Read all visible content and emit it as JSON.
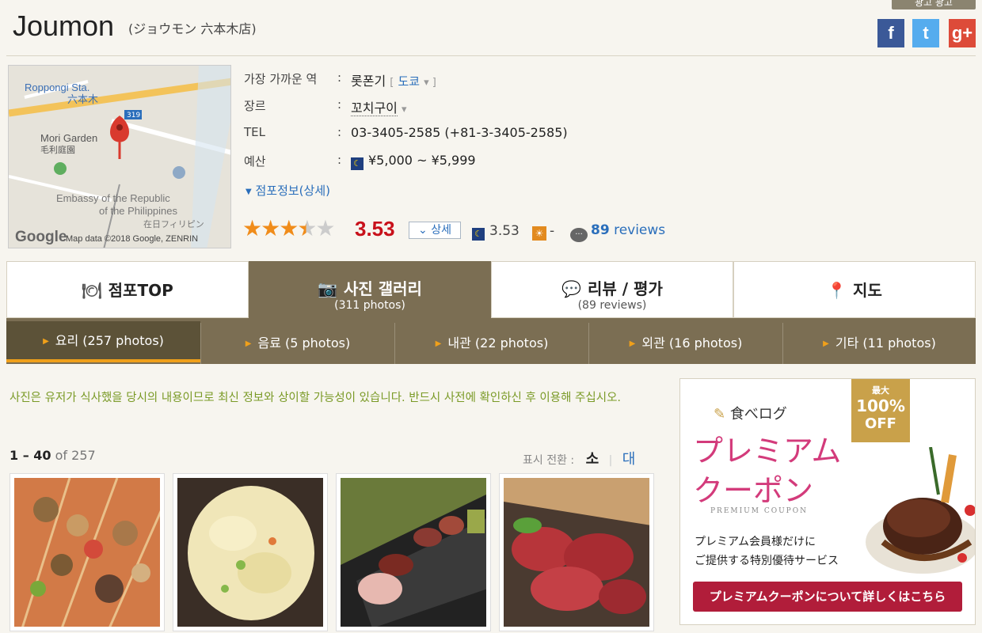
{
  "header": {
    "top_tag": "광고 광고",
    "title": "Joumon",
    "subtitle": "(ジョウモン 六本木店)",
    "social": [
      {
        "name": "facebook",
        "glyph": "f"
      },
      {
        "name": "twitter",
        "glyph": "t"
      },
      {
        "name": "google-plus",
        "glyph": "g+"
      }
    ]
  },
  "map": {
    "labels": [
      "Roppongi Sta.",
      "六本木",
      "Mori Garden",
      "毛利庭園",
      "Embassy of the Republic",
      "of the Philippines",
      "在日フィリピン",
      "Google",
      "Map data ©2018 Google, ZENRIN"
    ],
    "route_badge": "319"
  },
  "info": {
    "station_label": "가장 가까운 역",
    "station_value": "롯폰기",
    "station_city": "도쿄",
    "genre_label": "장르",
    "genre_value": "꼬치구이",
    "tel_label": "TEL",
    "tel_value": "03-3405-2585 (+81-3-3405-2585)",
    "budget_label": "예산",
    "budget_value": "¥5,000 ~ ¥5,999",
    "detail_link": "점포정보(상세)"
  },
  "rating": {
    "stars": 3.53,
    "score": "3.53",
    "detail_button": "상세",
    "night_score": "3.53",
    "day_score": "-",
    "review_count": "89",
    "review_label": "reviews"
  },
  "main_tabs": [
    {
      "label": "점포TOP",
      "sub": "",
      "icon": "restaurant-icon"
    },
    {
      "label": "사진 갤러리",
      "sub": "(311 photos)",
      "icon": "camera-icon"
    },
    {
      "label": "리뷰 / 평가",
      "sub": "(89 reviews)",
      "icon": "chat-icon"
    },
    {
      "label": "지도",
      "sub": "",
      "icon": "map-pin-icon"
    }
  ],
  "sub_tabs": [
    {
      "label": "요리 (257 photos)"
    },
    {
      "label": "음료 (5 photos)"
    },
    {
      "label": "내관 (22 photos)"
    },
    {
      "label": "외관 (16 photos)"
    },
    {
      "label": "기타 (11 photos)"
    }
  ],
  "content": {
    "notice": "사진은 유저가 식사했을 당시의 내용이므로 최신 정보와 상이할 가능성이 있습니다. 반드시 사전에 확인하신 후 이용해 주십시오.",
    "range": "1 – 40",
    "of_total": "of 257",
    "toggle_label": "표시 전환 :",
    "toggle_small": "소",
    "toggle_large": "대"
  },
  "ad": {
    "logo": "食べログ",
    "badge_top": "最大",
    "badge_percent": "100%",
    "badge_off": "OFF",
    "title_line1": "プレミアム",
    "title_line2": "クーポン",
    "subtitle_en": "PREMIUM COUPON",
    "desc_line1": "プレミアム会員様だけに",
    "desc_line2": "ご提供する特別優待サービス",
    "button": "プレミアムクーポンについて詳しくはこちら"
  },
  "colors": {
    "brand_brown": "#7b6e53",
    "accent_orange": "#f0a01a",
    "score_red": "#c8111b",
    "link_blue": "#2a6ebb",
    "notice_green": "#7a9a26"
  }
}
